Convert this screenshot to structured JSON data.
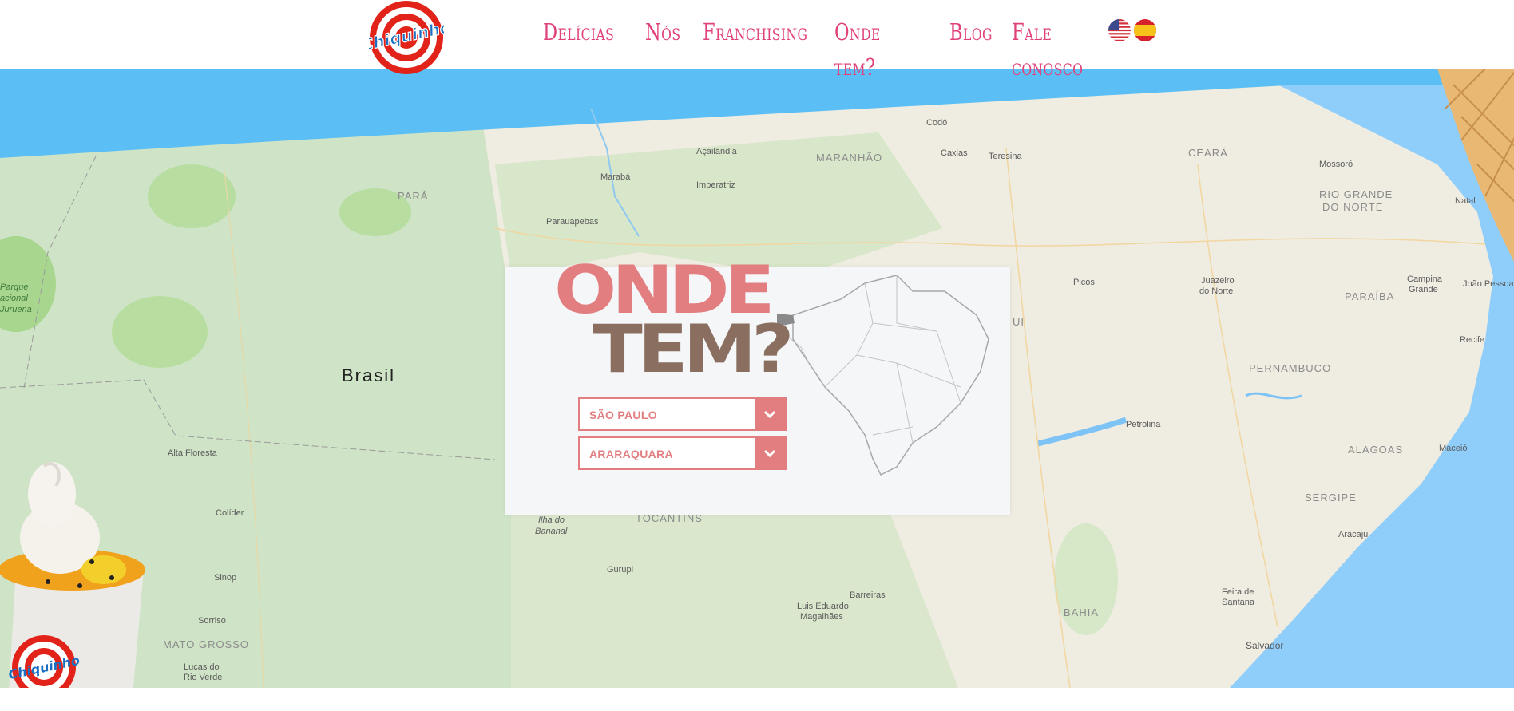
{
  "header": {
    "brand": "Chiquinho Sorvetes",
    "nav": [
      "Delícias",
      "Nós",
      "Franchising",
      "Onde tem?",
      "Blog",
      "Fale conosco"
    ],
    "flags": [
      "us-flag-icon",
      "es-flag-icon"
    ]
  },
  "map": {
    "country_label": "Brasil",
    "regions": [
      "PARÁ",
      "MARANHÃO",
      "CEARÁ",
      "RIO GRANDE",
      "DO NORTE",
      "PARAÍBA",
      "PERNAMBUCO",
      "ALAGOAS",
      "SERGIPE",
      "BAHIA",
      "TOCANTINS",
      "MATO GROSSO",
      "UI"
    ],
    "cities": [
      "Codó",
      "Açailândia",
      "Caxias",
      "Teresina",
      "Marabá",
      "Imperatriz",
      "Mossoró",
      "Natal",
      "Parauapebas",
      "Picos",
      "Juazeiro",
      "do Norte",
      "Campina",
      "Grande",
      "João Pessoa",
      "Recife",
      "Petrolina",
      "Maceió",
      "Aracaju",
      "Alta Floresta",
      "Colíder",
      "Sinop",
      "Sorriso",
      "Lucas do",
      "Rio Verde",
      "Ilha do",
      "Bananal",
      "Gurupi",
      "Luis Eduardo",
      "Magalhães",
      "Barreiras",
      "Feira de",
      "Santana",
      "Salvador",
      "Parque",
      "acional",
      "Juruena"
    ]
  },
  "finder": {
    "title_line1": "ONDE",
    "title_line2": "TEM?",
    "state_value": "SÃO PAULO",
    "city_value": "ARARAQUARA"
  },
  "colors": {
    "brand_pink": "#e0417a",
    "card_pink": "#e27e80",
    "card_brown": "#8a6e60",
    "sky_blue": "#5bbff5",
    "ocean_blue": "#8fcdfb"
  }
}
